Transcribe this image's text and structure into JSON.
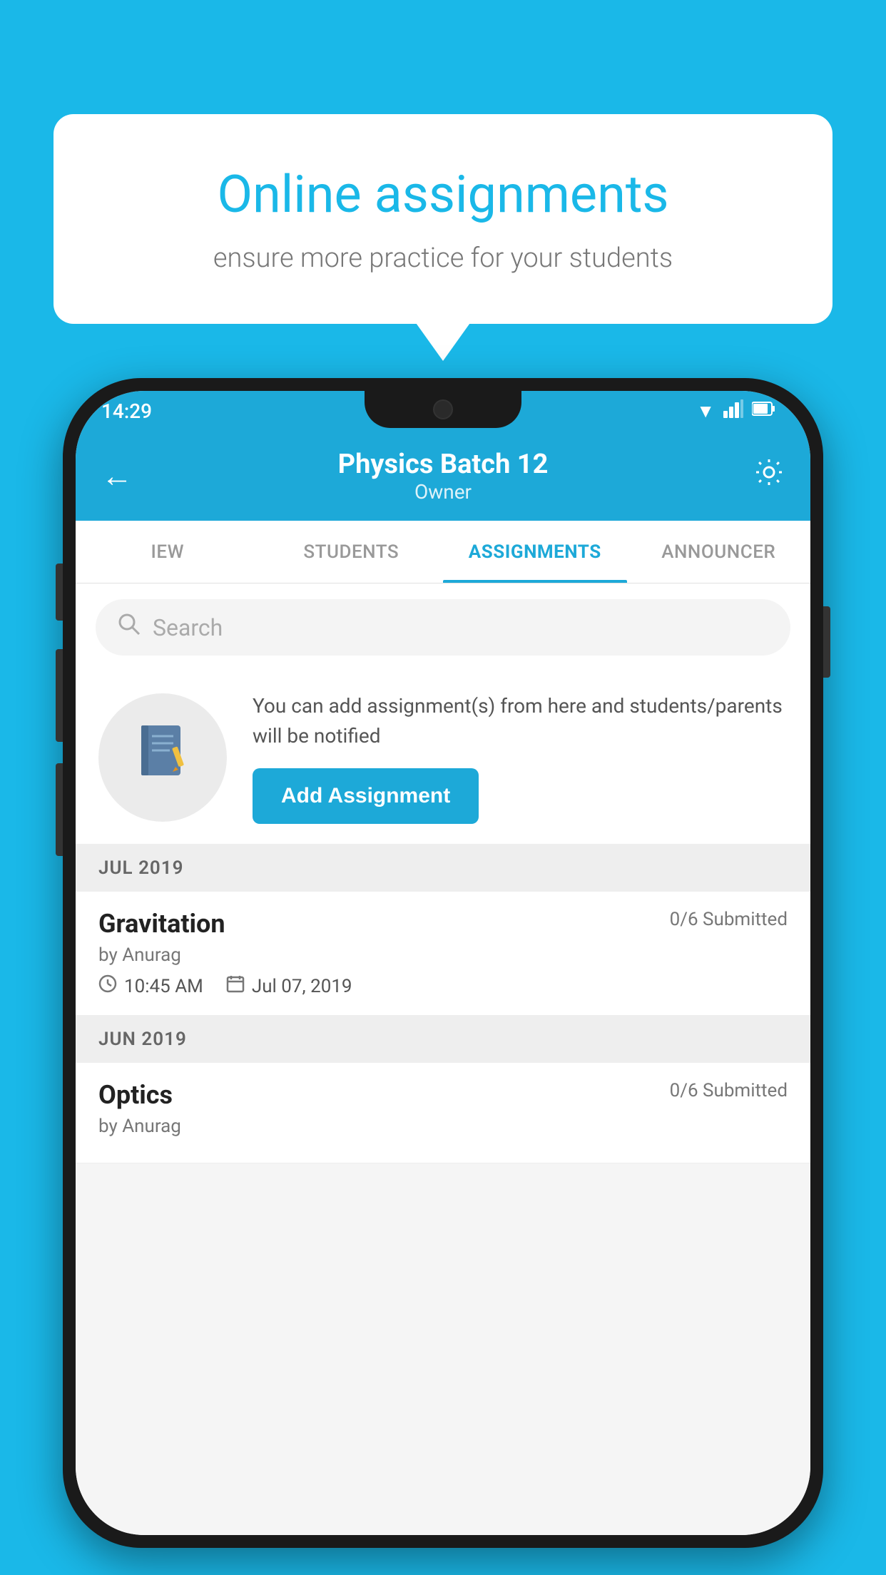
{
  "background_color": "#1ab8e8",
  "speech_bubble": {
    "title": "Online assignments",
    "subtitle": "ensure more practice for your students"
  },
  "phone": {
    "status_bar": {
      "time": "14:29",
      "wifi": "▼",
      "signal": "▲",
      "battery": "▮"
    },
    "header": {
      "title": "Physics Batch 12",
      "subtitle": "Owner",
      "back_label": "←",
      "settings_label": "⚙"
    },
    "tabs": [
      {
        "label": "IEW",
        "active": false
      },
      {
        "label": "STUDENTS",
        "active": false
      },
      {
        "label": "ASSIGNMENTS",
        "active": true
      },
      {
        "label": "ANNOUNCER",
        "active": false
      }
    ],
    "search": {
      "placeholder": "Search"
    },
    "promo": {
      "description": "You can add assignment(s) from here and students/parents will be notified",
      "button_label": "Add Assignment"
    },
    "sections": [
      {
        "month_label": "JUL 2019",
        "assignments": [
          {
            "name": "Gravitation",
            "submitted": "0/6 Submitted",
            "by": "by Anurag",
            "time": "10:45 AM",
            "date": "Jul 07, 2019"
          }
        ]
      },
      {
        "month_label": "JUN 2019",
        "assignments": [
          {
            "name": "Optics",
            "submitted": "0/6 Submitted",
            "by": "by Anurag",
            "time": "",
            "date": ""
          }
        ]
      }
    ]
  }
}
